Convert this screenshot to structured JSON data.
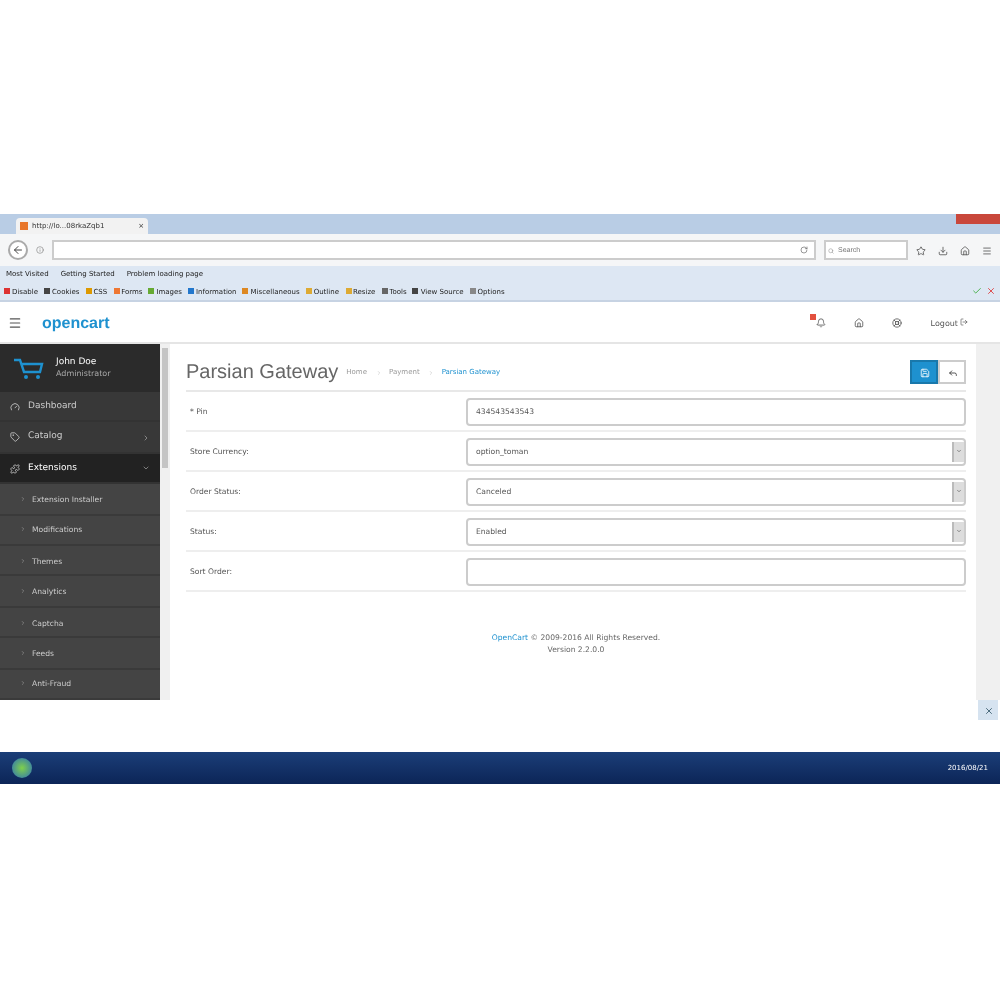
{
  "browser": {
    "tab": {
      "title": "http://lo...08rkaZqb1",
      "close": "×"
    },
    "search": {
      "placeholder": "Search"
    },
    "bookmarks": [
      "Most Visited",
      "Getting Started",
      "Problem loading page"
    ],
    "dev_toolbar": [
      "Disable",
      "Cookies",
      "CSS",
      "Forms",
      "Images",
      "Information",
      "Miscellaneous",
      "Outline",
      "Resize",
      "Tools",
      "View Source",
      "Options"
    ]
  },
  "header": {
    "logo": "opencart",
    "logout": "Logout"
  },
  "sidebar": {
    "user": {
      "name": "John Doe",
      "role": "Administrator"
    },
    "items": [
      {
        "label": "Dashboard",
        "kind": "link",
        "selected": false
      },
      {
        "label": "Catalog",
        "kind": "group",
        "selected": false,
        "expanded": false
      },
      {
        "label": "Extensions",
        "kind": "group",
        "selected": true,
        "expanded": true,
        "children": [
          {
            "label": "Extension Installer"
          },
          {
            "label": "Modifications"
          },
          {
            "label": "Themes"
          },
          {
            "label": "Analytics"
          },
          {
            "label": "Captcha"
          },
          {
            "label": "Feeds"
          },
          {
            "label": "Anti-Fraud"
          }
        ]
      }
    ]
  },
  "page": {
    "title": "Parsian Gateway",
    "breadcrumbs": [
      {
        "label": "Home",
        "selected": false
      },
      {
        "label": "Payment",
        "selected": false
      },
      {
        "label": "Parsian Gateway",
        "selected": true
      }
    ],
    "form": [
      {
        "label": "* Pin",
        "kind": "text",
        "value": "434543543543"
      },
      {
        "label": "Store Currency:",
        "kind": "select",
        "value": "option_toman"
      },
      {
        "label": "Order Status:",
        "kind": "select",
        "value": "Canceled"
      },
      {
        "label": "Status:",
        "kind": "select",
        "value": "Enabled"
      },
      {
        "label": "Sort Order:",
        "kind": "text"
      }
    ],
    "footer": {
      "link": "OpenCart",
      "text": "© 2009-2016 All Rights Reserved.",
      "version": "Version 2.2.0.0"
    }
  },
  "taskbar": {
    "date": "2016/08/21"
  }
}
